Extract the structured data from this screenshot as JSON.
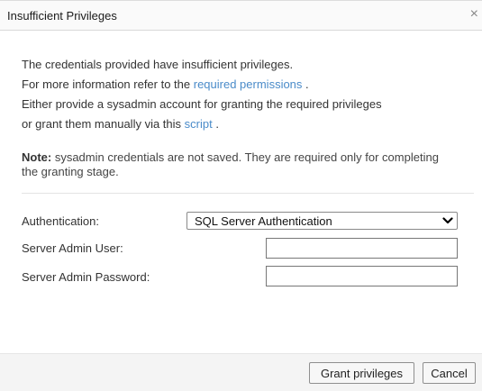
{
  "dialog": {
    "title": "Insufficient Privileges",
    "close_glyph": "×"
  },
  "message": {
    "line1": "The credentials provided have insufficient privileges.",
    "line2_prefix": "For more information refer to the ",
    "line2_link": "required permissions",
    "line2_suffix": " .",
    "line3": "Either provide a sysadmin account for granting the required privileges",
    "line4_prefix": "or grant them manually via this ",
    "line4_link": "script",
    "line4_suffix": " ."
  },
  "note": {
    "label": "Note:",
    "text": " sysadmin credentials are not saved. They are required only for completing the granting stage."
  },
  "form": {
    "auth_label": "Authentication:",
    "auth_value": "SQL Server Authentication",
    "user_label": "Server Admin User:",
    "user_value": "",
    "password_label": "Server Admin Password:",
    "password_value": ""
  },
  "buttons": {
    "grant": "Grant privileges",
    "cancel": "Cancel"
  },
  "colors": {
    "link": "#4a8bc9"
  },
  "icons": {
    "close": "close-icon",
    "dropdown": "chevron-down-icon"
  }
}
